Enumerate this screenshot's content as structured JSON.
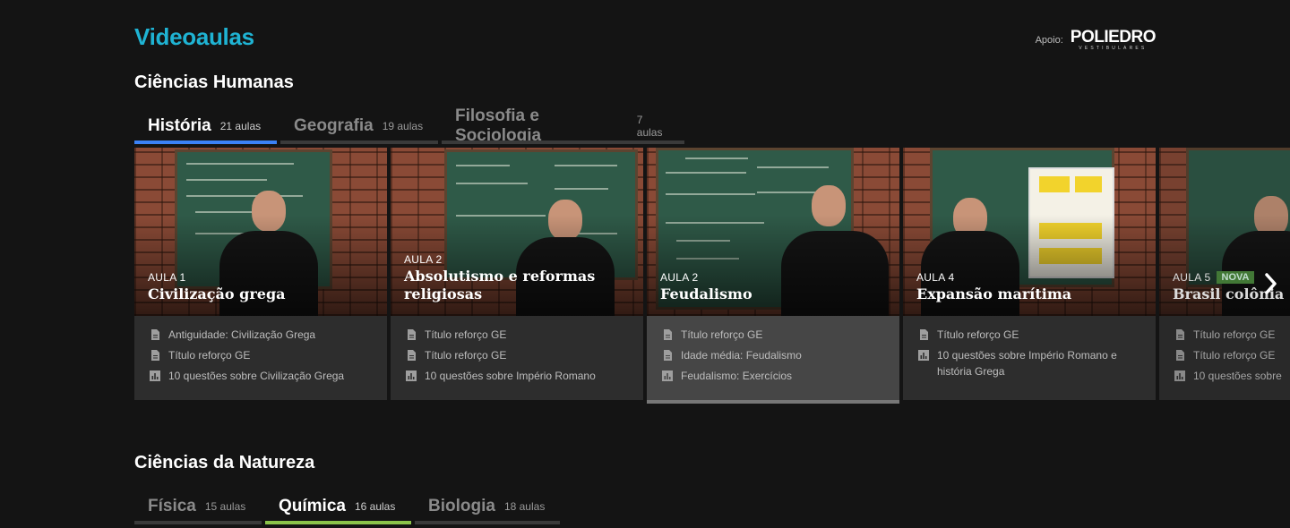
{
  "header": {
    "title": "Videoaulas",
    "sponsor_label": "Apoio:",
    "logo_main": "POLIEDRO",
    "logo_sub": "VESTIBULARES"
  },
  "sections": [
    {
      "title": "Ciências Humanas",
      "tabs": [
        {
          "name": "História",
          "count": "21 aulas"
        },
        {
          "name": "Geografia",
          "count": "19 aulas"
        },
        {
          "name": "Filosofia e Sociologia",
          "count": "7 aulas"
        }
      ]
    },
    {
      "title": "Ciências da Natureza",
      "tabs": [
        {
          "name": "Física",
          "count": "15 aulas"
        },
        {
          "name": "Química",
          "count": "16 aulas"
        },
        {
          "name": "Biologia",
          "count": "18 aulas"
        }
      ]
    }
  ],
  "cards": [
    {
      "lesson": "AULA 1",
      "title": "Civilização grega",
      "items": [
        {
          "icon": "document-icon",
          "text": "Antiguidade: Civilização Grega"
        },
        {
          "icon": "document-icon",
          "text": "Título reforço GE"
        },
        {
          "icon": "quiz-chart-icon",
          "text": "10 questões sobre Civilização Grega"
        }
      ]
    },
    {
      "lesson": "AULA 2",
      "title": "Absolutismo e reformas religiosas",
      "items": [
        {
          "icon": "document-icon",
          "text": "Título reforço GE"
        },
        {
          "icon": "document-icon",
          "text": "Título reforço GE"
        },
        {
          "icon": "quiz-chart-icon",
          "text": "10 questões sobre Império Romano"
        }
      ]
    },
    {
      "lesson": "AULA 2",
      "title": "Feudalismo",
      "items": [
        {
          "icon": "document-icon",
          "text": "Título reforço GE"
        },
        {
          "icon": "document-icon",
          "text": "Idade média: Feudalismo"
        },
        {
          "icon": "quiz-chart-icon",
          "text": "Feudalismo: Exercícios"
        }
      ]
    },
    {
      "lesson": "AULA 4",
      "title": "Expansão marítima",
      "items": [
        {
          "icon": "document-icon",
          "text": "Título reforço GE"
        },
        {
          "icon": "quiz-chart-icon",
          "text": "10 questões sobre Império Romano e história Grega"
        }
      ]
    },
    {
      "lesson": "AULA 5",
      "badge": "NOVA",
      "title": "Brasil colônia",
      "items": [
        {
          "icon": "document-icon",
          "text": "Título reforço GE"
        },
        {
          "icon": "document-icon",
          "text": "Título reforço GE"
        },
        {
          "icon": "quiz-chart-icon",
          "text": "10 questões sobre"
        }
      ]
    }
  ],
  "colors": {
    "accent_title": "#1fb3d3",
    "tab_blue": "#3b82f6",
    "tab_green": "#8bc34a",
    "badge_new": "#4b8a3c"
  }
}
